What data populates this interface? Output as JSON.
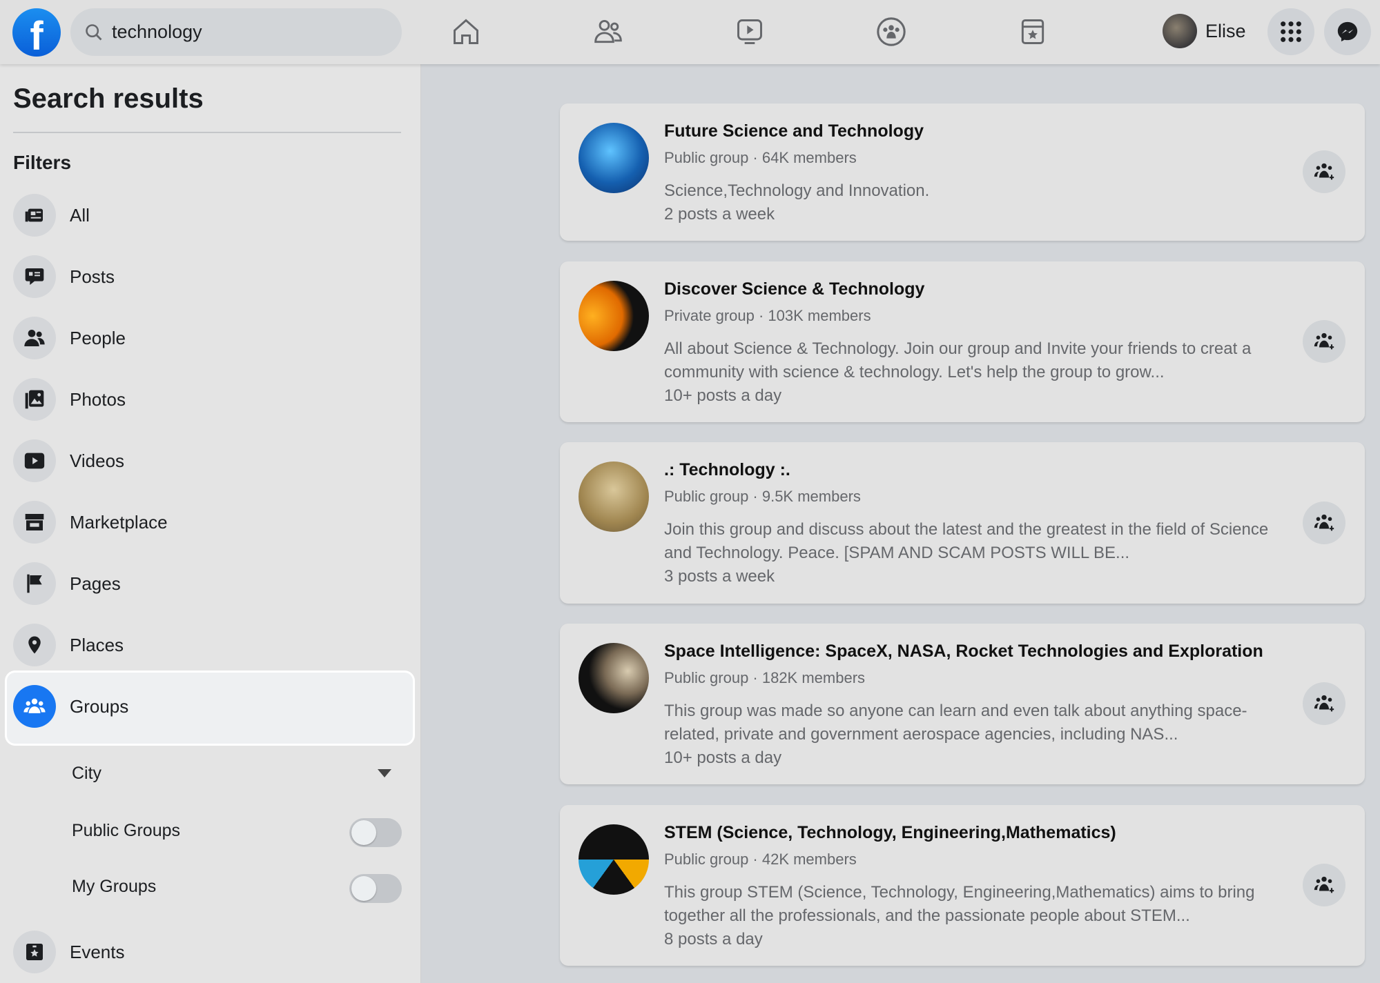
{
  "topbar": {
    "logo": "f",
    "search_value": "technology",
    "search_icon": "search-icon",
    "nav": [
      "home-icon",
      "friends-icon",
      "watch-icon",
      "groups-icon",
      "gaming-icon"
    ],
    "user_name": "Elise",
    "menu_icon": "grid-menu-icon",
    "messenger_icon": "messenger-icon",
    "brand_color": "#1877f2"
  },
  "sidebar": {
    "title": "Search results",
    "filters_label": "Filters",
    "items": [
      {
        "label": "All"
      },
      {
        "label": "Posts"
      },
      {
        "label": "People"
      },
      {
        "label": "Photos"
      },
      {
        "label": "Videos"
      },
      {
        "label": "Marketplace"
      },
      {
        "label": "Pages"
      },
      {
        "label": "Places"
      },
      {
        "label": "Groups",
        "selected": true
      },
      {
        "label": "Events"
      }
    ],
    "group_filters": {
      "city": "City",
      "public_groups": "Public Groups",
      "public_groups_on": false,
      "my_groups": "My Groups",
      "my_groups_on": false
    }
  },
  "results": [
    {
      "name": "Future Science and Technology",
      "meta": "Public group · 64K members",
      "desc": "Science,Technology and Innovation.",
      "freq": "2 posts a week"
    },
    {
      "name": "Discover Science & Technology",
      "meta": "Private group · 103K members",
      "desc": "All about Science & Technology. Join our group and Invite your friends to creat a community with science & technology. Let's help the group to grow...",
      "freq": "10+ posts a day"
    },
    {
      "name": ".: Technology :.",
      "meta": "Public group · 9.5K members",
      "desc": "Join this group and discuss about the latest and the greatest in the field of Science and Technology. Peace. [SPAM AND SCAM POSTS WILL BE...",
      "freq": "3 posts a week"
    },
    {
      "name": "Space Intelligence: SpaceX, NASA, Rocket Technologies and Exploration",
      "meta": "Public group · 182K members",
      "desc": "This group was made so anyone can learn and even talk about anything space-related, private and government aerospace agencies, including NAS...",
      "freq": "10+ posts a day"
    },
    {
      "name": "STEM (Science, Technology, Engineering,Mathematics)",
      "meta": "Public group · 42K members",
      "desc": "This group STEM (Science, Technology, Engineering,Mathematics) aims to bring together all the professionals, and the passionate people about STEM...",
      "freq": "8 posts a day"
    }
  ]
}
